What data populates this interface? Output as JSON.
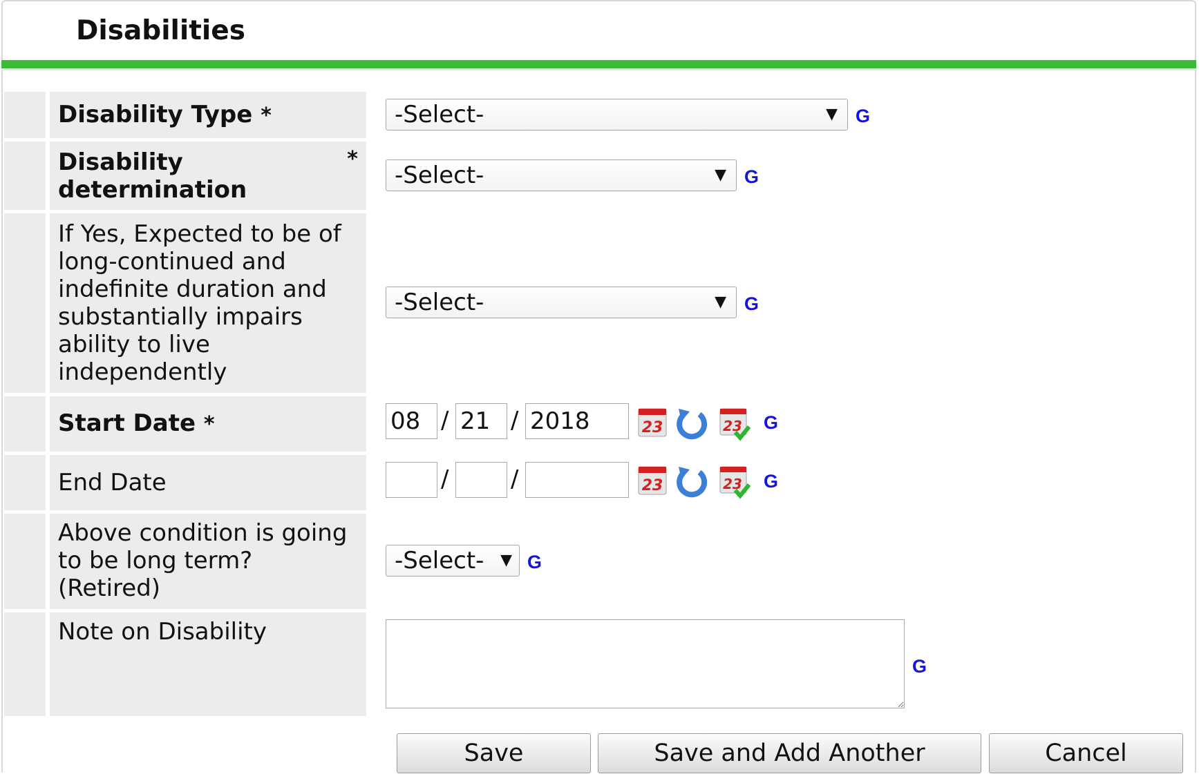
{
  "form": {
    "title": "Disabilities",
    "required_marker": "*",
    "help_link": "G",
    "date_separator": "/"
  },
  "fields": {
    "disability_type": {
      "label": "Disability Type",
      "value": "-Select-"
    },
    "disability_determination": {
      "label_line1": "Disability",
      "label_line2": "determination",
      "value": "-Select-"
    },
    "long_continued": {
      "label_lines": [
        "If Yes, Expected to be of",
        "long-continued and",
        "indefinite duration and",
        "substantially impairs",
        "ability to live",
        "independently"
      ],
      "value": "-Select-"
    },
    "start_date": {
      "label": "Start Date",
      "month": "08",
      "day": "21",
      "year": "2018"
    },
    "end_date": {
      "label": "End Date",
      "month": "",
      "day": "",
      "year": ""
    },
    "long_term_retired": {
      "label_lines": [
        "Above condition is going",
        "to be long term?",
        "(Retired)"
      ],
      "value": "-Select-"
    },
    "note": {
      "label": "Note on Disability",
      "value": ""
    }
  },
  "buttons": {
    "save": "Save",
    "save_add": "Save and Add Another",
    "cancel": "Cancel"
  },
  "icons": {
    "calendar": "calendar-icon",
    "reset": "refresh-icon",
    "today": "calendar-check-icon"
  },
  "colors": {
    "accent_bar": "#3dbb38",
    "help_link": "#1414e0",
    "label_bg": "#ececec"
  }
}
